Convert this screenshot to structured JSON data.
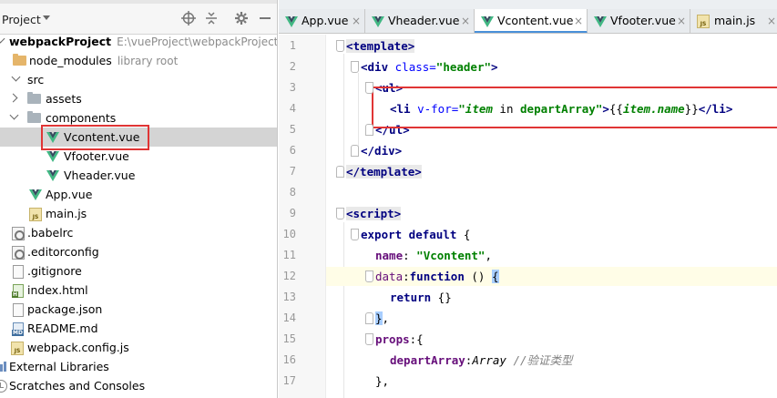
{
  "project_panel": {
    "title": "Project",
    "toolbar_icons": [
      "crosshair-icon",
      "collapse-icon",
      "gear-icon",
      "hide-icon"
    ],
    "tree": [
      {
        "label": "webpackProject",
        "extra": "E:\\vueProject\\webpackProject",
        "icon": "folder-icon",
        "expanded": true
      },
      {
        "label": "node_modules",
        "extra": "library root",
        "icon": "folder-icon"
      },
      {
        "label": "src",
        "icon": "folder-icon",
        "expanded": true
      },
      {
        "label": "assets",
        "icon": "folder-icon",
        "expanded": false
      },
      {
        "label": "components",
        "icon": "folder-icon",
        "expanded": true
      },
      {
        "label": "Vcontent.vue",
        "icon": "vue-icon",
        "selected": true
      },
      {
        "label": "Vfooter.vue",
        "icon": "vue-icon"
      },
      {
        "label": "Vheader.vue",
        "icon": "vue-icon"
      },
      {
        "label": "App.vue",
        "icon": "vue-icon"
      },
      {
        "label": "main.js",
        "icon": "js-icon"
      },
      {
        "label": ".babelrc",
        "icon": "config-file-icon"
      },
      {
        "label": ".editorconfig",
        "icon": "config-file-icon"
      },
      {
        "label": ".gitignore",
        "icon": "text-file-icon"
      },
      {
        "label": "index.html",
        "icon": "html-file-icon"
      },
      {
        "label": "package.json",
        "icon": "json-file-icon"
      },
      {
        "label": "README.md",
        "icon": "markdown-file-icon"
      },
      {
        "label": "webpack.config.js",
        "icon": "js-icon"
      },
      {
        "label": "External Libraries",
        "icon": "library-icon"
      },
      {
        "label": "Scratches and Consoles",
        "icon": "scratch-icon"
      }
    ]
  },
  "tabs": [
    {
      "label": "App.vue",
      "icon": "vue-icon",
      "close": "×",
      "active": false
    },
    {
      "label": "Vheader.vue",
      "icon": "vue-icon",
      "close": "×",
      "active": false
    },
    {
      "label": "Vcontent.vue",
      "icon": "vue-icon",
      "close": "×",
      "active": true
    },
    {
      "label": "Vfooter.vue",
      "icon": "vue-icon",
      "close": "×",
      "active": false
    },
    {
      "label": "main.js",
      "icon": "js-icon",
      "close": "×",
      "active": false
    }
  ],
  "editor": {
    "line_numbers": [
      "1",
      "2",
      "3",
      "4",
      "5",
      "6",
      "7",
      "8",
      "9",
      "10",
      "11",
      "12",
      "13",
      "14",
      "15",
      "16",
      "17"
    ],
    "code": {
      "l1": {
        "open": "<template>"
      },
      "l2": {
        "open": "<div",
        "attr": "class=",
        "val": "\"header\"",
        "close": ">"
      },
      "l3": {
        "open": "<ul>"
      },
      "l4": {
        "open": "<li",
        "attr": "v-for=",
        "q1": "\"",
        "item": "item",
        "in": " in ",
        "arr": "departArray",
        "q2": "\"",
        "gt": ">",
        "m1": "{{",
        "expr": "item.name",
        "m2": "}}",
        "close": "</li>"
      },
      "l5": {
        "close": "</ul>"
      },
      "l6": {
        "close": "</div>"
      },
      "l7": {
        "close": "</template>"
      },
      "l9": {
        "open": "<script>"
      },
      "l10": {
        "kw": "export default",
        "rest": " {"
      },
      "l11": {
        "key": "name",
        "colon": ": ",
        "val": "\"Vcontent\"",
        "comma": ","
      },
      "l12": {
        "key": "data",
        "colon": ":",
        "kw": "function",
        "paren": " () ",
        "brace": "{"
      },
      "l13": {
        "kw": "return",
        "rest": " {}"
      },
      "l14": {
        "brace": "}",
        "comma": ","
      },
      "l15": {
        "key": "props",
        "rest": ":{"
      },
      "l16": {
        "key": "departArray",
        "colon": ":",
        "type": "Array",
        "comment": " //验证类型"
      },
      "l17": {
        "rest": "},"
      }
    }
  },
  "colors": {
    "highlight_box": "#e03535",
    "active_tab_underline": "#4a90d9",
    "selection": "#d4d4d4",
    "vue_green": "#41b883",
    "vue_dark": "#35495e"
  }
}
